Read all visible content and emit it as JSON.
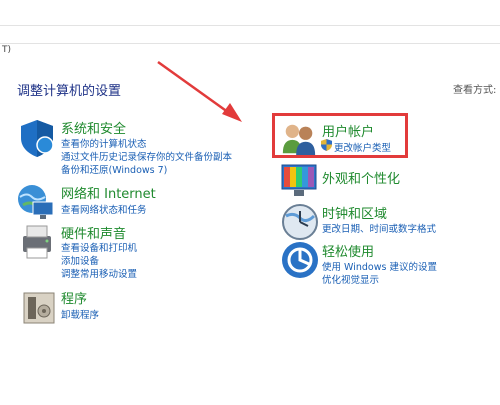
{
  "menu_stub": "T)",
  "page_title": "调整计算机的设置",
  "view_by": "查看方式:",
  "categories": {
    "system": {
      "title": "系统和安全",
      "links": [
        "查看你的计算机状态",
        "通过文件历史记录保存你的文件备份副本",
        "备份和还原(Windows 7)"
      ]
    },
    "network": {
      "title": "网络和 Internet",
      "links": [
        "查看网络状态和任务"
      ]
    },
    "hardware": {
      "title": "硬件和声音",
      "links": [
        "查看设备和打印机",
        "添加设备",
        "调整常用移动设置"
      ]
    },
    "programs": {
      "title": "程序",
      "links": [
        "卸载程序"
      ]
    },
    "users": {
      "title": "用户帐户",
      "links": [
        "更改帐户类型"
      ]
    },
    "appearance": {
      "title": "外观和个性化",
      "links": []
    },
    "clock": {
      "title": "时钟和区域",
      "links": [
        "更改日期、时间或数字格式"
      ]
    },
    "ease": {
      "title": "轻松使用",
      "links": [
        "使用 Windows 建议的设置",
        "优化视觉显示"
      ]
    }
  },
  "colors": {
    "title": "#1f8a2e",
    "link": "#1a5fb4",
    "heading": "#1e3287",
    "annotation": "#e23b3b"
  }
}
